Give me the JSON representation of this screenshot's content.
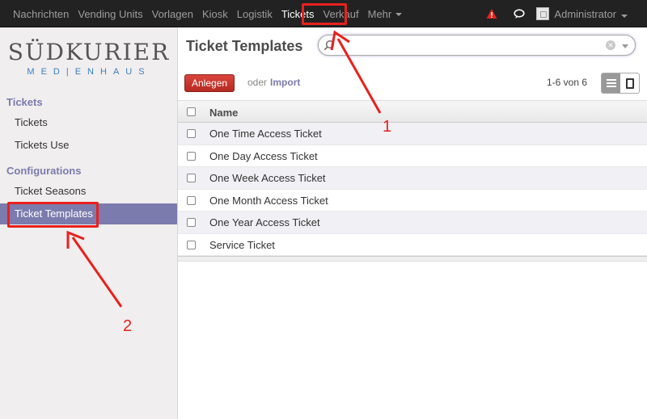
{
  "topnav": {
    "items": [
      {
        "label": "Nachrichten"
      },
      {
        "label": "Vending Units"
      },
      {
        "label": "Vorlagen"
      },
      {
        "label": "Kiosk"
      },
      {
        "label": "Logistik"
      },
      {
        "label": "Tickets"
      },
      {
        "label": "Verkauf"
      },
      {
        "label": "Mehr"
      }
    ],
    "user": "Administrator"
  },
  "sidebar": {
    "logo": {
      "main": "SÜDKURIER",
      "sub": "MED|ENHAUS"
    },
    "sections": [
      {
        "title": "Tickets",
        "items": [
          "Tickets",
          "Tickets Use"
        ]
      },
      {
        "title": "Configurations",
        "items": [
          "Ticket Seasons",
          "Ticket Templates"
        ]
      }
    ]
  },
  "main": {
    "title": "Ticket Templates",
    "search": {
      "value": "",
      "placeholder": ""
    },
    "create_label": "Anlegen",
    "or_label": "oder",
    "import_label": "Import",
    "pager": "1-6 von 6",
    "table": {
      "column": "Name",
      "rows": [
        "One Time Access Ticket",
        "One Day Access Ticket",
        "One Week Access Ticket",
        "One Month Access Ticket",
        "One Year Access Ticket",
        "Service Ticket"
      ]
    }
  },
  "annotations": {
    "label1": "1",
    "label2": "2"
  },
  "colors": {
    "accent": "#7c7bad",
    "create": "#c9362d",
    "annotation": "#e8211d",
    "nav_bg": "#222222"
  }
}
